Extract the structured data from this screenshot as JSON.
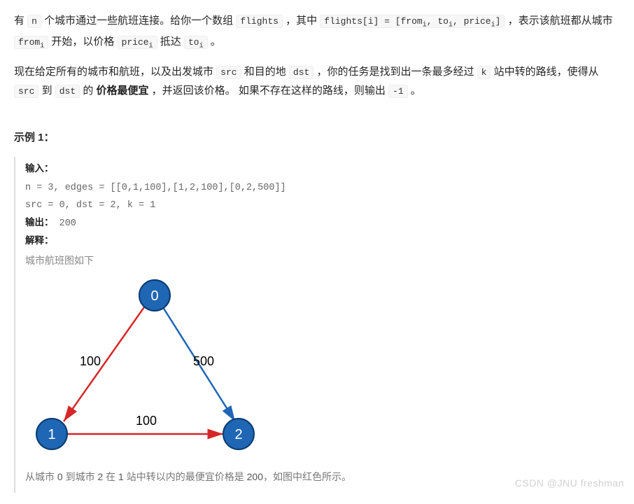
{
  "intro": {
    "p1a": "有 ",
    "p1_n": "n",
    "p1b": " 个城市通过一些航班连接。给你一个数组 ",
    "p1_flights": "flights",
    "p1c": " ，其中 ",
    "p1_fi": "flights[i] = [from",
    "p1_fi_sub1": "i",
    "p1_fi_mid": ", to",
    "p1_fi_sub2": "i",
    "p1_fi_mid2": ", price",
    "p1_fi_sub3": "i",
    "p1_fi_end": "]",
    "p1d": " ，表示该航班都从城市 ",
    "p1_from": "from",
    "p1_from_sub": "i",
    "p1e": " 开始，以价格 ",
    "p1_price": "price",
    "p1_price_sub": "i",
    "p1f": " 抵达 ",
    "p1_to": "to",
    "p1_to_sub": "i",
    "p1g": " 。",
    "p2a": "现在给定所有的城市和航班，以及出发城市 ",
    "p2_src": "src",
    "p2b": " 和目的地 ",
    "p2_dst": "dst",
    "p2c": " ，你的任务是找到出一条最多经过 ",
    "p2_k": "k",
    "p2d": " 站中转的路线，使得从 ",
    "p2_src2": "src",
    "p2e": " 到 ",
    "p2_dst2": "dst",
    "p2f": " 的 ",
    "p2_bold": "价格最便宜",
    "p2g": " ，并返回该价格。 如果不存在这样的路线，则输出 ",
    "p2_neg1": "-1",
    "p2h": " 。"
  },
  "example_heading": "示例 1：",
  "example": {
    "input_label": "输入：",
    "input_line1": "n = 3, edges = [[0,1,100],[1,2,100],[0,2,500]]",
    "input_line2": "src = 0, dst = 2, k = 1",
    "output_label": "输出：",
    "output_value": "200",
    "explain_label": "解释：",
    "explain_text": "城市航班图如下",
    "caption_a": "从城市 ",
    "caption_n0": "0",
    "caption_b": " 到城市 ",
    "caption_n2": "2",
    "caption_c": " 在 ",
    "caption_n1": "1",
    "caption_d": " 站中转以内的最便宜价格是 ",
    "caption_n200": "200",
    "caption_e": "，如图中红色所示。"
  },
  "graph": {
    "node0": "0",
    "node1": "1",
    "node2": "2",
    "e01": "100",
    "e12": "100",
    "e02": "500"
  },
  "watermark": "CSDN @JNU freshman"
}
